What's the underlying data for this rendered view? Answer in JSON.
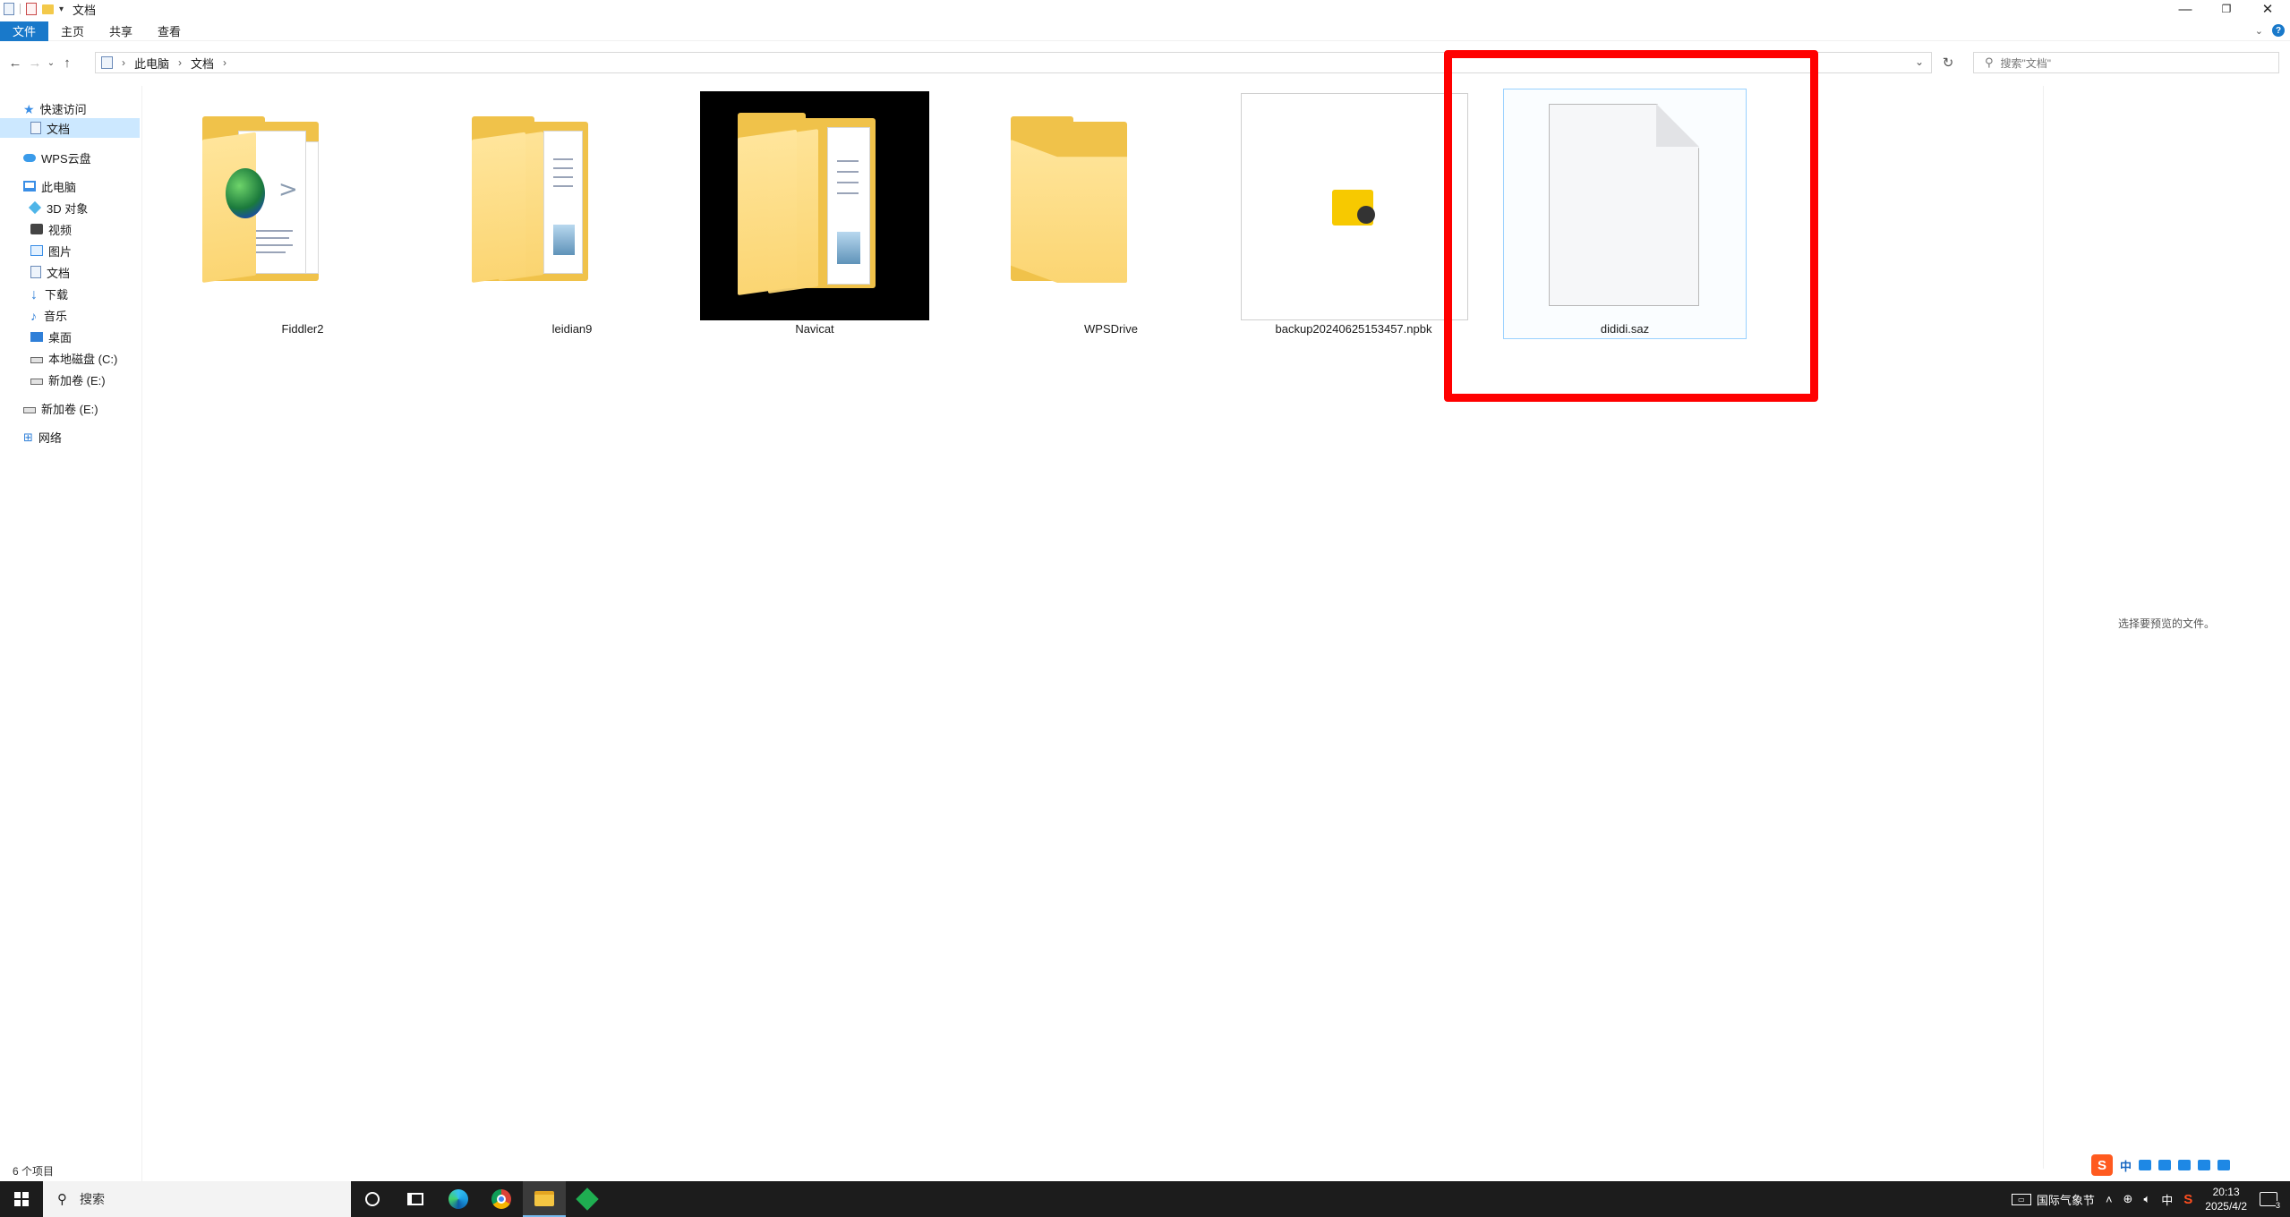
{
  "window": {
    "title": "文档",
    "controls": {
      "minimize": "—",
      "restore": "❐",
      "close": "✕"
    }
  },
  "ribbon": {
    "tabs": [
      "文件",
      "主页",
      "共享",
      "查看"
    ]
  },
  "address": {
    "crumbs": [
      "此电脑",
      "文档"
    ],
    "search_placeholder": "搜索\"文档\""
  },
  "nav": {
    "items": [
      {
        "label": "快速访问",
        "icon": "star-icon"
      },
      {
        "label": "文档",
        "icon": "documents-icon",
        "selected": true
      },
      {
        "label": "WPS云盘",
        "icon": "cloud-icon"
      },
      {
        "label": "此电脑",
        "icon": "computer-icon"
      },
      {
        "label": "3D 对象",
        "icon": "cube-icon"
      },
      {
        "label": "视频",
        "icon": "video-icon"
      },
      {
        "label": "图片",
        "icon": "pictures-icon"
      },
      {
        "label": "文档",
        "icon": "documents-icon"
      },
      {
        "label": "下载",
        "icon": "download-icon"
      },
      {
        "label": "音乐",
        "icon": "music-icon"
      },
      {
        "label": "桌面",
        "icon": "desktop-icon"
      },
      {
        "label": "本地磁盘 (C:)",
        "icon": "drive-icon"
      },
      {
        "label": "新加卷 (E:)",
        "icon": "drive-icon"
      },
      {
        "label": "新加卷 (E:)",
        "icon": "drive-icon"
      },
      {
        "label": "网络",
        "icon": "network-icon"
      }
    ]
  },
  "files": [
    {
      "name": "Fiddler2",
      "type": "folder"
    },
    {
      "name": "leidian9",
      "type": "folder"
    },
    {
      "name": "Navicat",
      "type": "folder"
    },
    {
      "name": "WPSDrive",
      "type": "folder"
    },
    {
      "name": "backup20240625153457.npbk",
      "type": "file"
    },
    {
      "name": "dididi.saz",
      "type": "file"
    }
  ],
  "preview": {
    "text": "选择要预览的文件。"
  },
  "status": {
    "count": "6 个项目"
  },
  "taskbar": {
    "search_label": "搜索",
    "weather": "国际气象节",
    "time": "20:13",
    "date": "2025/4/2",
    "ime": "中",
    "notifications": "3"
  },
  "colors": {
    "accent": "#1979ca",
    "annotation": "#ff0000",
    "selection": "#cce8ff"
  }
}
